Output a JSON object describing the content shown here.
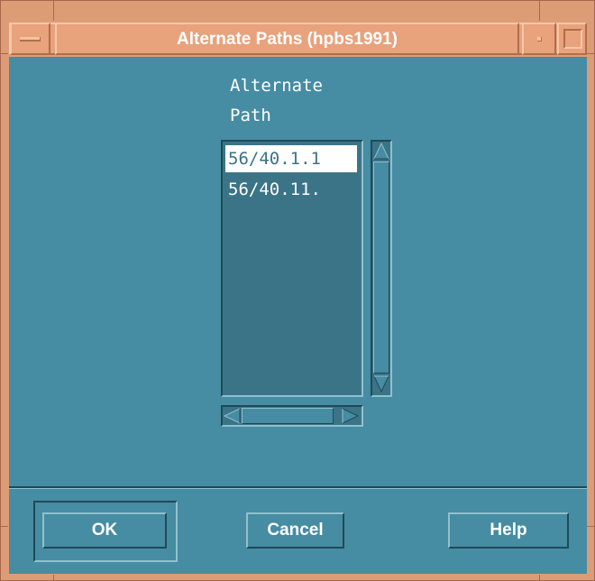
{
  "window": {
    "title": "Alternate Paths (hpbs1991)"
  },
  "content": {
    "label_line1": "Alternate",
    "label_line2": "Path",
    "paths": [
      {
        "text": "56/40.1.1",
        "selected": true
      },
      {
        "text": "56/40.11.",
        "selected": false
      }
    ]
  },
  "buttons": {
    "ok": "OK",
    "cancel": "Cancel",
    "help": "Help"
  },
  "colors": {
    "frame": "#dc9d76",
    "titlebar": "#e8a27c",
    "client_background": "#468ca3",
    "list_background": "#3c7487",
    "selection": "#ffffff"
  },
  "icons": {
    "window_menu": "window-menu-icon",
    "minimize": "minimize-icon",
    "maximize": "maximize-icon",
    "scroll_up": "arrow-up-icon",
    "scroll_down": "arrow-down-icon",
    "scroll_left": "arrow-left-icon",
    "scroll_right": "arrow-right-icon"
  }
}
